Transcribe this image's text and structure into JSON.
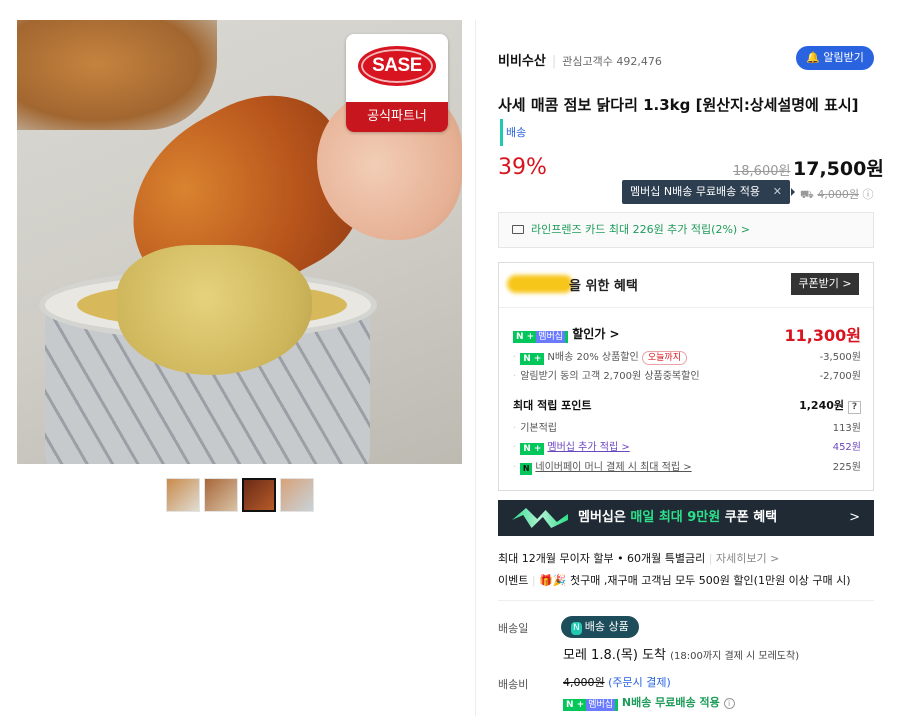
{
  "gallery": {
    "badge_brand": "SASE",
    "badge_label": "공식파트너"
  },
  "store": {
    "name": "비비수산",
    "fans_label": "관심고객수 492,476",
    "alarm_button": "알림받기"
  },
  "product": {
    "title": "사세 매콤 점보 닭다리 1.3kg [원산지:상세설명에 표시]",
    "delivery_tag": "배송",
    "discount_rate": "39%",
    "original_price": "18,600원",
    "sale_price": "17,500원",
    "tooltip": "멤버십 N배송 무료배송 적용",
    "tooltip_close": "✕",
    "shipping_icon": "truck-icon",
    "shipping_original": "4,000원",
    "info_icon": "ⓘ"
  },
  "card_promo": "라인프렌즈 카드 최대 226원 추가 적립(2%) >",
  "benefits": {
    "title": "을 위한 혜택",
    "coupon_button": "쿠폰받기 >",
    "nplus_badge": "N +",
    "membership_chip": "멤버십",
    "sale_label": "할인가 >",
    "sale_price": "11,300원",
    "discounts": [
      {
        "label": "N배송 20% 상품할인",
        "tag": "오늘까지",
        "value": "-3,500원"
      },
      {
        "label": "알림받기 동의 고객 2,700원 상품중복할인",
        "value": "-2,700원"
      }
    ],
    "points_label": "최대 적립 포인트",
    "points_total": "1,240원",
    "points_help": "?",
    "points": [
      {
        "label": "기본적립",
        "value": "113원"
      },
      {
        "label": "멤버십 추가 적립 >",
        "value": "452원"
      },
      {
        "label": "네이버페이 머니 결제 시 최대 적립 >",
        "value": "225원"
      }
    ]
  },
  "banner": {
    "text_a": "멤버십은 ",
    "text_hl": "매일 최대 9만원",
    "text_b": " 쿠폰 혜택",
    "arrow": ">"
  },
  "installment": {
    "text": "최대 12개월 무이자 할부 • 60개월 특별금리",
    "link": "자세히보기 >"
  },
  "event": {
    "label": "이벤트",
    "icons": "🎁🎉",
    "text": "첫구매 ,재구매 고객님 모두 500원 할인(1만원 이상 구매 시)"
  },
  "delivery": {
    "date_label": "배송일",
    "badge_icon": "N",
    "badge_text": "배송 상품",
    "arrival": "모레 1.8.(목) 도착",
    "arrival_note": "(18:00까지 결제 시 모레도착)",
    "fee_label": "배송비",
    "fee_original": "4,000원",
    "fee_note": "(주문시 결제)",
    "free_text": "N배송 무료배송 적용",
    "free_info": "i"
  }
}
